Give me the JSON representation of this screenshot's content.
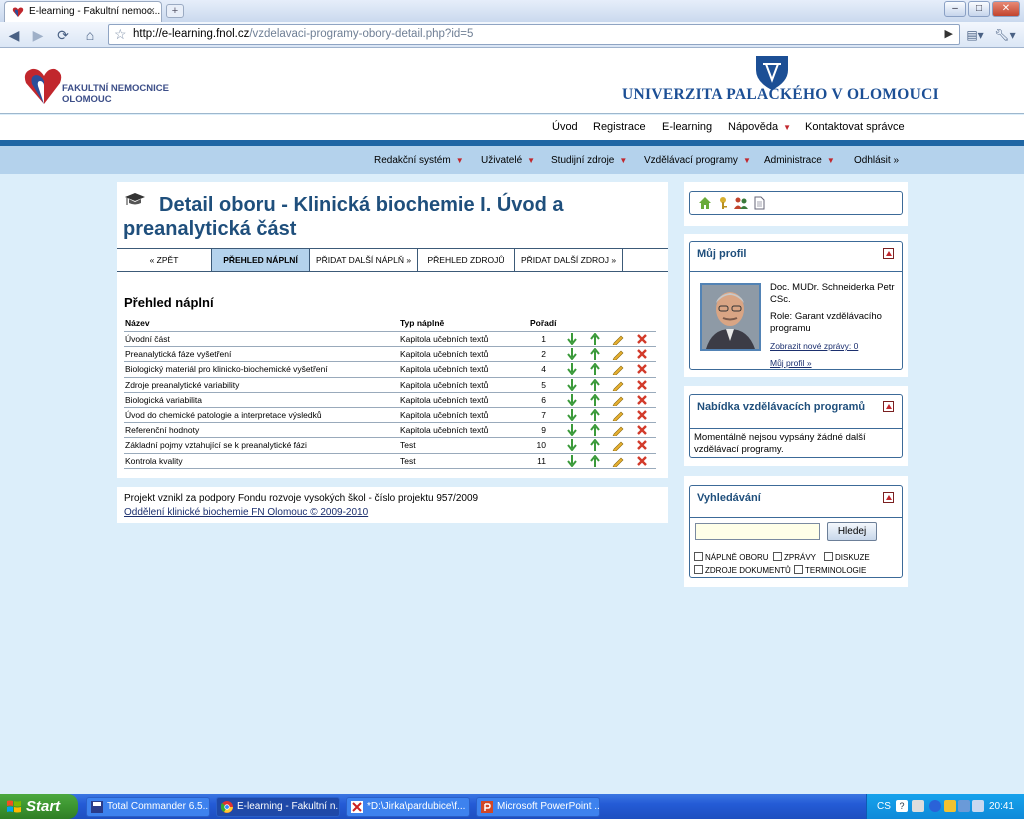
{
  "browser": {
    "tab_title": "E-learning - Fakultní nemoc...",
    "tab_close": "×",
    "new_tab": "+",
    "url_host": "http://e-learning.fnol.cz",
    "url_path": "/vzdelavaci-programy-obory-detail.php?id=5",
    "controls": {
      "minimize": "–",
      "maximize": "□",
      "close": "✕"
    }
  },
  "header": {
    "fn_logo_text": "FAKULTNÍ NEMOCNICE OLOMOUC",
    "university_name": "UNIVERZITA PALACKÉHO V OLOMOUCI"
  },
  "top_nav": [
    {
      "label": "Úvod",
      "caret": false
    },
    {
      "label": "Registrace",
      "caret": false
    },
    {
      "label": "E-learning",
      "caret": false
    },
    {
      "label": "Nápověda",
      "caret": true
    },
    {
      "label": "Kontaktovat správce",
      "caret": false
    }
  ],
  "sub_nav": [
    {
      "label": "Redakční systém",
      "caret": true
    },
    {
      "label": "Uživatelé",
      "caret": true
    },
    {
      "label": "Studijní zdroje",
      "caret": true
    },
    {
      "label": "Vzdělávací programy",
      "caret": true
    },
    {
      "label": "Administrace",
      "caret": true
    },
    {
      "label": "Odhlásit »",
      "caret": false
    }
  ],
  "main": {
    "title": "Detail oboru - Klinická biochemie I. Úvod a preanalytická část",
    "tabs": [
      "« ZPĚT",
      "PŘEHLED NÁPLNÍ",
      "PŘIDAT DALŠÍ NÁPLŇ »",
      "PŘEHLED ZDROJŮ",
      "PŘIDAT DALŠÍ ZDROJ »"
    ],
    "active_tab": 1,
    "section_title": "Přehled náplní",
    "columns": {
      "name": "Název",
      "type": "Typ náplně",
      "order": "Pořadí"
    },
    "rows": [
      {
        "name": "Úvodní část",
        "type": "Kapitola učebních textů",
        "order": "1"
      },
      {
        "name": "Preanalytická fáze vyšetření",
        "type": "Kapitola učebních textů",
        "order": "2"
      },
      {
        "name": "Biologický materiál pro klinicko-biochemické vyšetření",
        "type": "Kapitola učebních textů",
        "order": "4"
      },
      {
        "name": "Zdroje preanalytické variability",
        "type": "Kapitola učebních textů",
        "order": "5"
      },
      {
        "name": "Biologická variabilita",
        "type": "Kapitola učebních textů",
        "order": "6"
      },
      {
        "name": "Úvod do chemické patologie a interpretace výsledků",
        "type": "Kapitola učebních textů",
        "order": "7"
      },
      {
        "name": "Referenční hodnoty",
        "type": "Kapitola učebních textů",
        "order": "9"
      },
      {
        "name": "Základní pojmy vztahující se k preanalytické fázi",
        "type": "Test",
        "order": "10"
      },
      {
        "name": "Kontrola kvality",
        "type": "Test",
        "order": "11"
      }
    ]
  },
  "footer": {
    "project_text": "Projekt vznikl za podpory Fondu rozvoje vysokých škol - číslo projektu 957/2009",
    "link_text": "Oddělení klinické biochemie FN Olomouc © 2009-2010"
  },
  "sidebar": {
    "profile": {
      "title": "Můj profil",
      "name": "Doc. MUDr. Schneiderka Petr CSc.",
      "role": "Role: Garant vzdělávacího programu",
      "messages_link": "Zobrazit nové zprávy: 0",
      "profile_link": "Můj profil »"
    },
    "programs": {
      "title": "Nabídka vzdělávacích programů",
      "text": "Momentálně nejsou vypsány žádné další vzdělávací programy."
    },
    "search": {
      "title": "Vyhledávání",
      "input_value": "",
      "button": "Hledej",
      "options": [
        "NÁPLNĚ OBORU",
        "ZPRÁVY",
        "DISKUZE",
        "ZDROJE DOKUMENTŮ",
        "TERMINOLOGIE"
      ]
    }
  },
  "taskbar": {
    "start": "Start",
    "tasks": [
      "Total Commander 6.5...",
      "E-learning - Fakultní n...",
      "*D:\\Jirka\\pardubice\\f...",
      "Microsoft PowerPoint ..."
    ],
    "active_task": 1,
    "lang": "CS",
    "clock": "20:41"
  },
  "colors": {
    "title_blue": "#1f4f7c",
    "band_blue": "#1f66a4",
    "subnav_bg": "#b4d2ec",
    "caret_red": "#c1272d",
    "page_bg": "#dceefa"
  }
}
